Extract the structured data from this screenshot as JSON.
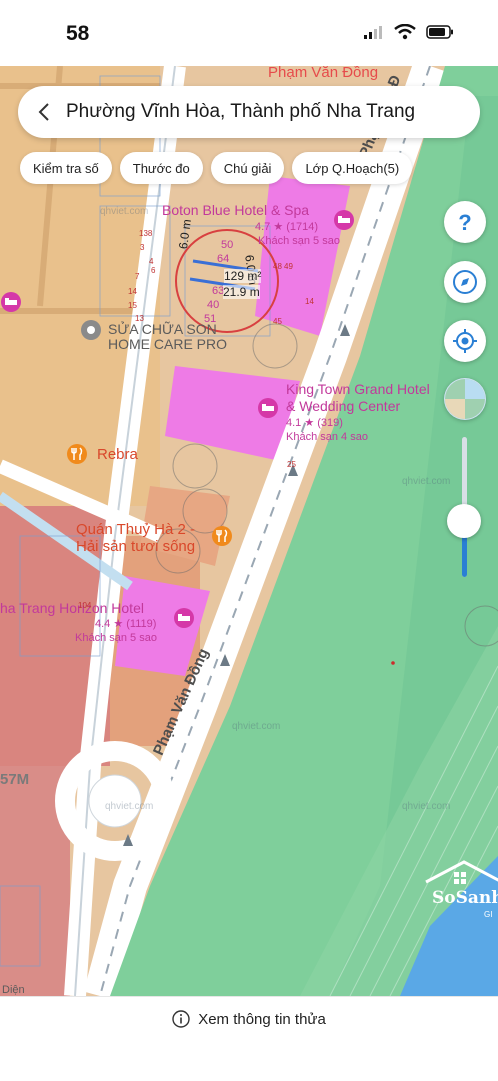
{
  "status_bar": {
    "time": "58"
  },
  "header": {
    "title": "Phường Vĩnh Hòa, Thành phố Nha Trang"
  },
  "chips": [
    {
      "label": "Kiểm tra số"
    },
    {
      "label": "Thước đo"
    },
    {
      "label": "Chú giải"
    },
    {
      "label": "Lớp Q.Hoạch(5)"
    }
  ],
  "map": {
    "streets": {
      "top": "Phạm Văn Đồng",
      "right": "Phạm Văn Đ",
      "bottom": "Phạm Văn Đồng"
    },
    "pois": {
      "boton": {
        "name": "Boton Blue Hotel & Spa",
        "rating": "4.7 ★ (1714)",
        "category": "Khách sạn 5 sao"
      },
      "kingtown": {
        "name_line1": "King Town Grand Hotel",
        "name_line2": "& Wedding Center",
        "rating": "4.1 ★ (319)",
        "category": "Khách sạn 4 sao"
      },
      "horizon": {
        "name": "ha Trang Horizon Hotel",
        "rating": "4.4 ★ (1119)",
        "category": "Khách sạn 5 sao"
      },
      "homecare": {
        "line1": "SỬA CHỮA SON",
        "line2": "HOME CARE PRO"
      },
      "rebra": {
        "name": "Rebra"
      },
      "quanthuy": {
        "line1": "Quán Thuỷ Hà 2 -",
        "line2": "Hải sản tươi sống"
      }
    },
    "parcel_numbers": [
      "138",
      "3",
      "4",
      "6",
      "7",
      "14",
      "15",
      "13",
      "50",
      "64",
      "63",
      "40",
      "51",
      "48",
      "49",
      "14",
      "45",
      "25",
      "104"
    ],
    "measurements": {
      "width_left": "6.0 m",
      "width_right": "6.0 m",
      "area": "129 m²",
      "length": "21.9 m"
    },
    "watermarks": [
      "qhviet.com",
      "qhviet.com",
      "qhviet.com",
      "qhviet.com",
      "qhviet.com"
    ],
    "other_labels": {
      "left_edge": "57M",
      "bottom_left": "Diện"
    },
    "brand": {
      "name": "SoSanh",
      "suffix": "GI"
    }
  },
  "controls": {
    "help_icon": "help-icon",
    "compass_icon": "compass-icon",
    "locate_icon": "locate-icon",
    "layers_icon": "layers-icon",
    "zoom_level": 0.4
  },
  "bottom": {
    "action_label": "Xem thông tin thửa"
  }
}
